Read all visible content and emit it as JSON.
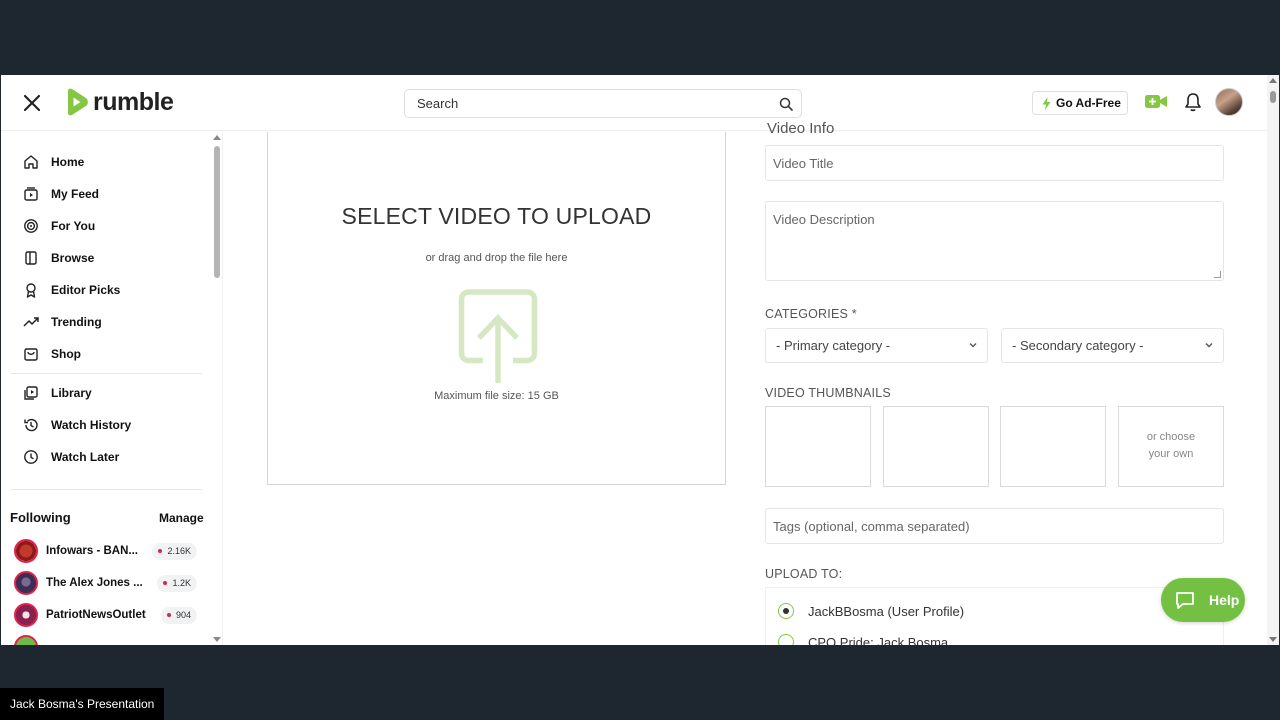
{
  "header": {
    "logo_text": "rumble",
    "search_placeholder": "Search",
    "go_adfree_label": "Go Ad-Free"
  },
  "sidebar": {
    "nav": [
      {
        "label": "Home",
        "icon": "home-icon"
      },
      {
        "label": "My Feed",
        "icon": "feed-icon"
      },
      {
        "label": "For You",
        "icon": "target-icon"
      },
      {
        "label": "Browse",
        "icon": "browse-icon"
      },
      {
        "label": "Editor Picks",
        "icon": "award-icon"
      },
      {
        "label": "Trending",
        "icon": "trending-icon"
      },
      {
        "label": "Shop",
        "icon": "shop-icon"
      }
    ],
    "library": [
      {
        "label": "Library",
        "icon": "library-icon"
      },
      {
        "label": "Watch History",
        "icon": "history-icon"
      },
      {
        "label": "Watch Later",
        "icon": "clock-icon"
      }
    ],
    "following_title": "Following",
    "manage_label": "Manage",
    "following": [
      {
        "name": "Infowars - BAN...",
        "count": "2.16K"
      },
      {
        "name": "The Alex Jones ...",
        "count": "1.2K"
      },
      {
        "name": "PatriotNewsOutlet",
        "count": "904"
      }
    ]
  },
  "upload": {
    "title": "SELECT VIDEO TO UPLOAD",
    "subtitle": "or drag and drop the file here",
    "max_size": "Maximum file size: 15 GB"
  },
  "form": {
    "section_header": "Video Info",
    "title_placeholder": "Video Title",
    "description_placeholder": "Video Description",
    "categories_label": "CATEGORIES *",
    "primary_category": "- Primary category -",
    "secondary_category": "- Secondary category -",
    "thumbnails_label": "VIDEO THUMBNAILS",
    "choose_own": "or choose your own",
    "tags_placeholder": "Tags (optional, comma separated)",
    "upload_to_label": "UPLOAD TO:",
    "upload_targets": [
      {
        "label": "JackBBosma (User Profile)",
        "checked": true
      },
      {
        "label": "CPO Pride: Jack Bosma",
        "checked": false
      }
    ]
  },
  "help_label": "Help",
  "presenter_label": "Jack Bosma's Presentation",
  "colors": {
    "brand_green": "#85c742",
    "help_green": "#74c043",
    "badge_dot": "#e2224a",
    "frame_bg": "#1e2630"
  }
}
